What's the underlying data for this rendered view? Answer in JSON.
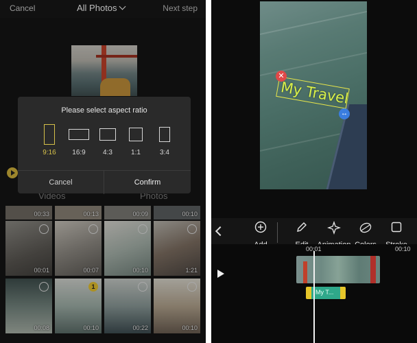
{
  "left": {
    "topbar": {
      "cancel": "Cancel",
      "title": "All Photos",
      "next": "Next step"
    },
    "dialog": {
      "title": "Please select aspect ratio",
      "ratios": [
        {
          "label": "9:16",
          "selected": true
        },
        {
          "label": "16:9",
          "selected": false
        },
        {
          "label": "4:3",
          "selected": false
        },
        {
          "label": "1:1",
          "selected": false
        },
        {
          "label": "3:4",
          "selected": false
        }
      ],
      "cancel": "Cancel",
      "confirm": "Confirm"
    },
    "tabs": [
      "Videos",
      "Photos"
    ],
    "grid": [
      {
        "duration": "00:33"
      },
      {
        "duration": "00:13"
      },
      {
        "duration": "00:09"
      },
      {
        "duration": "00:10"
      },
      {
        "duration": "00:01"
      },
      {
        "duration": "00:07"
      },
      {
        "duration": "00:10"
      },
      {
        "duration": "1:21"
      },
      {
        "duration": "00:08"
      },
      {
        "duration": "00:10",
        "badge": "1"
      },
      {
        "duration": "00:22"
      },
      {
        "duration": "00:10"
      }
    ],
    "colors": {
      "accent": "#d6c14a"
    }
  },
  "right": {
    "overlay_text": "My Travel",
    "tools": [
      {
        "label": "Add",
        "icon": "plus-circle-icon"
      },
      {
        "label": "Edit",
        "icon": "pencil-icon"
      },
      {
        "label": "Animation",
        "icon": "sparkle-icon"
      },
      {
        "label": "Colors",
        "icon": "palette-icon"
      },
      {
        "label": "Stroke",
        "icon": "square-outline-icon"
      }
    ],
    "timeline": {
      "time_start": "00:01",
      "time_end": "00:10",
      "text_clip_label": "My T..."
    }
  }
}
